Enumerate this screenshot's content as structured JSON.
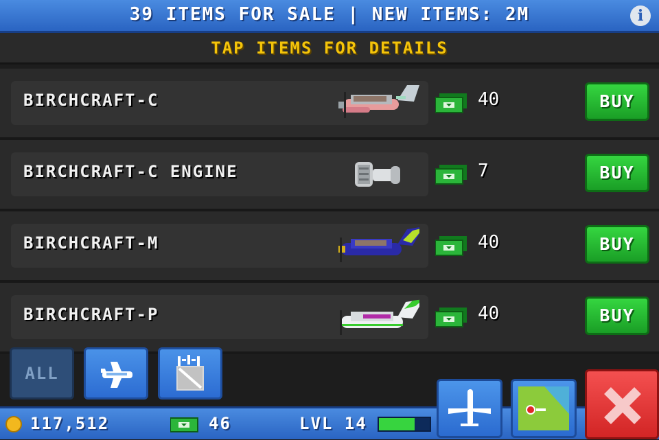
{
  "header": {
    "title": "39 ITEMS FOR SALE | NEW ITEMS: 2M",
    "info_icon": "info-icon",
    "subtitle": "TAP ITEMS FOR DETAILS"
  },
  "items": [
    {
      "name": "BIRCHCRAFT-C",
      "price": "40",
      "buy_label": "BUY",
      "image": "plane-birchcraft-c-icon"
    },
    {
      "name": "BIRCHCRAFT-C ENGINE",
      "price": "7",
      "buy_label": "BUY",
      "image": "engine-icon"
    },
    {
      "name": "BIRCHCRAFT-M",
      "price": "40",
      "buy_label": "BUY",
      "image": "plane-birchcraft-m-icon"
    },
    {
      "name": "BIRCHCRAFT-P",
      "price": "40",
      "buy_label": "BUY",
      "image": "plane-birchcraft-p-icon"
    }
  ],
  "filters": {
    "all_label": "ALL",
    "planes_icon": "plane-icon",
    "parts_icon": "part-crate-icon"
  },
  "status": {
    "coins": "117,512",
    "bux": "46",
    "level": "LVL 14",
    "xp_progress": 0.7
  },
  "nav": {
    "flights_icon": "airplane-icon",
    "map_icon": "map-icon",
    "close_icon": "close-icon"
  },
  "colors": {
    "header_blue": "#3a78d4",
    "accent_yellow": "#f4c40a",
    "buy_green": "#2bc236",
    "close_red": "#e33434"
  }
}
